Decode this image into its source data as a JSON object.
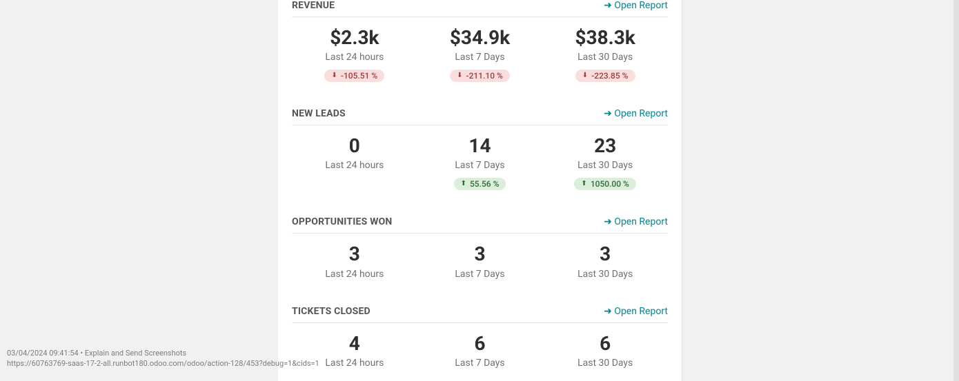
{
  "common": {
    "open_report": "➜ Open Report",
    "period_24h": "Last 24 hours",
    "period_7d": "Last 7 Days",
    "period_30d": "Last 30 Days"
  },
  "revenue": {
    "title": "REVENUE",
    "v24": "$2.3k",
    "v7": "$34.9k",
    "v30": "$38.3k",
    "d24": "-105.51 %",
    "d7": "-211.10 %",
    "d30": "-223.85 %"
  },
  "leads": {
    "title": "NEW LEADS",
    "v24": "0",
    "v7": "14",
    "v30": "23",
    "d7": "55.56 %",
    "d30": "1050.00 %"
  },
  "oppwon": {
    "title": "OPPORTUNITIES WON",
    "v24": "3",
    "v7": "3",
    "v30": "3"
  },
  "tickets": {
    "title": "TICKETS CLOSED",
    "v24": "4",
    "v7": "6",
    "v30": "6"
  },
  "watermark": {
    "line1": "03/04/2024 09:41:54 • Explain and Send Screenshots",
    "line2": "https://60763769-saas-17-2-all.runbot180.odoo.com/odoo/action-128/453?debug=1&cids=1"
  }
}
